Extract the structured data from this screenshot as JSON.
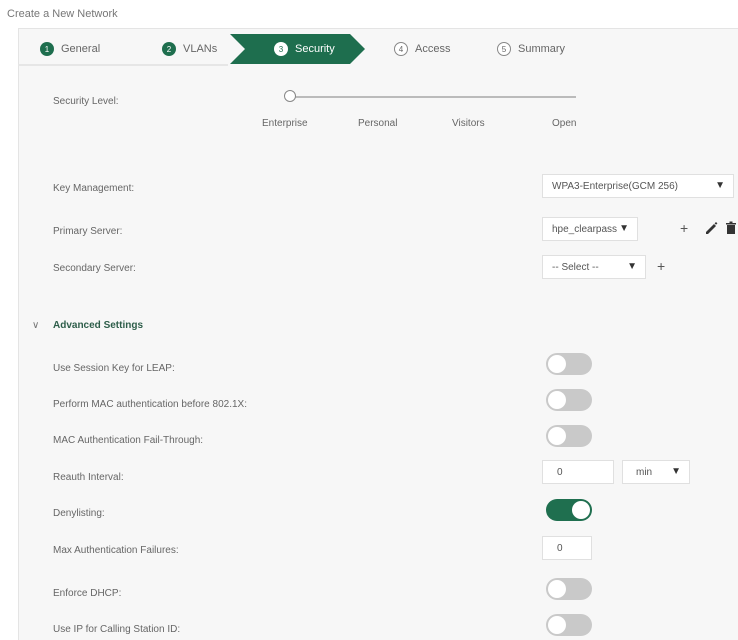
{
  "page": {
    "title": "Create a New Network"
  },
  "wizard": {
    "steps": [
      {
        "num": "1",
        "label": "General"
      },
      {
        "num": "2",
        "label": "VLANs"
      },
      {
        "num": "3",
        "label": "Security"
      },
      {
        "num": "4",
        "label": "Access"
      },
      {
        "num": "5",
        "label": "Summary"
      }
    ],
    "active_index": 2
  },
  "security_level": {
    "label": "Security Level:",
    "options": [
      "Enterprise",
      "Personal",
      "Visitors",
      "Open"
    ],
    "selected": "Enterprise"
  },
  "fields": {
    "key_management": {
      "label": "Key Management:",
      "value": "WPA3-Enterprise(GCM 256)"
    },
    "primary_server": {
      "label": "Primary Server:",
      "value": "hpe_clearpass"
    },
    "secondary_server": {
      "label": "Secondary Server:",
      "value": "-- Select --"
    }
  },
  "advanced": {
    "title": "Advanced Settings",
    "rows": [
      {
        "label": "Use Session Key for LEAP:",
        "type": "toggle",
        "on": false
      },
      {
        "label": "Perform MAC authentication before 802.1X:",
        "type": "toggle",
        "on": false
      },
      {
        "label": "MAC Authentication Fail-Through:",
        "type": "toggle",
        "on": false
      },
      {
        "label": "Reauth Interval:",
        "type": "input-select",
        "value": "0",
        "unit": "min"
      },
      {
        "label": "Denylisting:",
        "type": "toggle",
        "on": true
      },
      {
        "label": "Max Authentication Failures:",
        "type": "input",
        "value": "0"
      },
      {
        "label": "Enforce DHCP:",
        "type": "toggle",
        "on": false
      },
      {
        "label": "Use IP for Calling Station ID:",
        "type": "toggle",
        "on": false
      }
    ]
  },
  "icons": {
    "add": "plus-icon",
    "edit": "pencil-icon",
    "delete": "trash-icon",
    "expand": "chevron-down-icon",
    "dropdown": "caret-down-icon"
  },
  "colors": {
    "accent": "#1e6e4e",
    "toggle_off": "#c9c9c9"
  }
}
